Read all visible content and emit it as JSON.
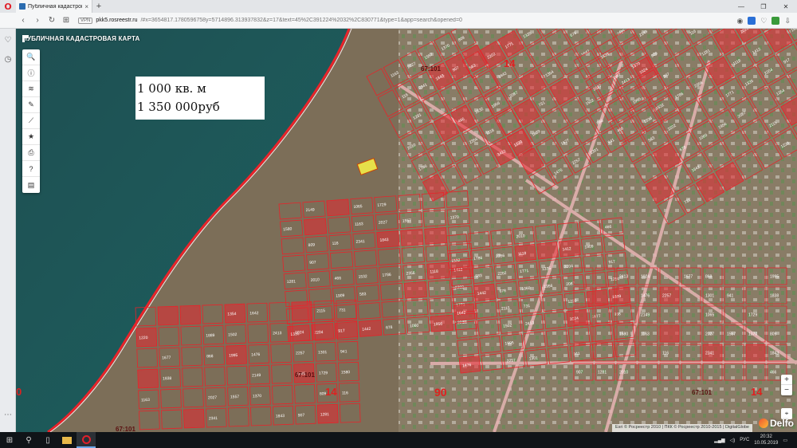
{
  "browser": {
    "logo": "O",
    "tab_title": "Публичная кадастровая к",
    "tab_close": "×",
    "newtab": "+",
    "url_host": "pkk5.rosreestr.ru",
    "url_rest": "/#x=3654817.1780596758y=5714896.313937832&z=17&text=45%2C391224%2032%2C830771&type=1&app=search&opened=0",
    "vpn_label": "VPN",
    "win_min": "—",
    "win_max": "❐",
    "win_close": "✕"
  },
  "map": {
    "app_title": "ПУБЛИЧНАЯ КАДАСТРОВАЯ КАРТА",
    "price_area": "1 000 кв. м",
    "price_value": "1 350 000руб",
    "attribution": "Esri © Росреестр 2010 | ПКК © Росреестр 2010-2015 | DigitalGlobe",
    "watermark": "Delfo",
    "labels": [
      {
        "text": "14"
      },
      {
        "text": "14"
      },
      {
        "text": "90"
      },
      {
        "text": "14"
      },
      {
        "text": "0"
      }
    ],
    "quarter_labels": [
      "67:101",
      "67:101",
      "67:101",
      "67:101"
    ],
    "parcel_numbers": [
      "1163",
      "2027",
      "1557",
      "1370",
      "809",
      "116",
      "2341",
      "1843",
      "907",
      "1281",
      "2010",
      "466",
      "1532",
      "1786",
      "2356",
      "1118",
      "1412",
      "1909",
      "583",
      "2202",
      "1771",
      "1335",
      "2204",
      "917",
      "1442",
      "678",
      "1060",
      "1956",
      "2087",
      "1354",
      "1642",
      "2115",
      "731",
      "1220",
      "1889",
      "1502",
      "2413",
      "1024",
      "1677",
      "868",
      "1995",
      "1476",
      "2257",
      "1301",
      "941",
      "1838",
      "2149",
      "1065",
      "1729",
      "1580"
    ],
    "zoom_in": "+",
    "zoom_out": "−",
    "locate": "⌖"
  },
  "tools": [
    {
      "name": "search-tool",
      "icon": "🔍"
    },
    {
      "name": "info-tool",
      "icon": "ⓘ"
    },
    {
      "name": "layers-tool",
      "icon": "≋"
    },
    {
      "name": "draw-tool",
      "icon": "✎"
    },
    {
      "name": "measure-tool",
      "icon": "⟋"
    },
    {
      "name": "favorites-tool",
      "icon": "★"
    },
    {
      "name": "print-tool",
      "icon": "⎙"
    },
    {
      "name": "help-tool",
      "icon": "?"
    },
    {
      "name": "legend-tool",
      "icon": "▤"
    }
  ],
  "taskbar": {
    "start": "⊞",
    "search": "⚲",
    "lang": "РУС",
    "time": "20:32",
    "date": "10.05.2019"
  }
}
